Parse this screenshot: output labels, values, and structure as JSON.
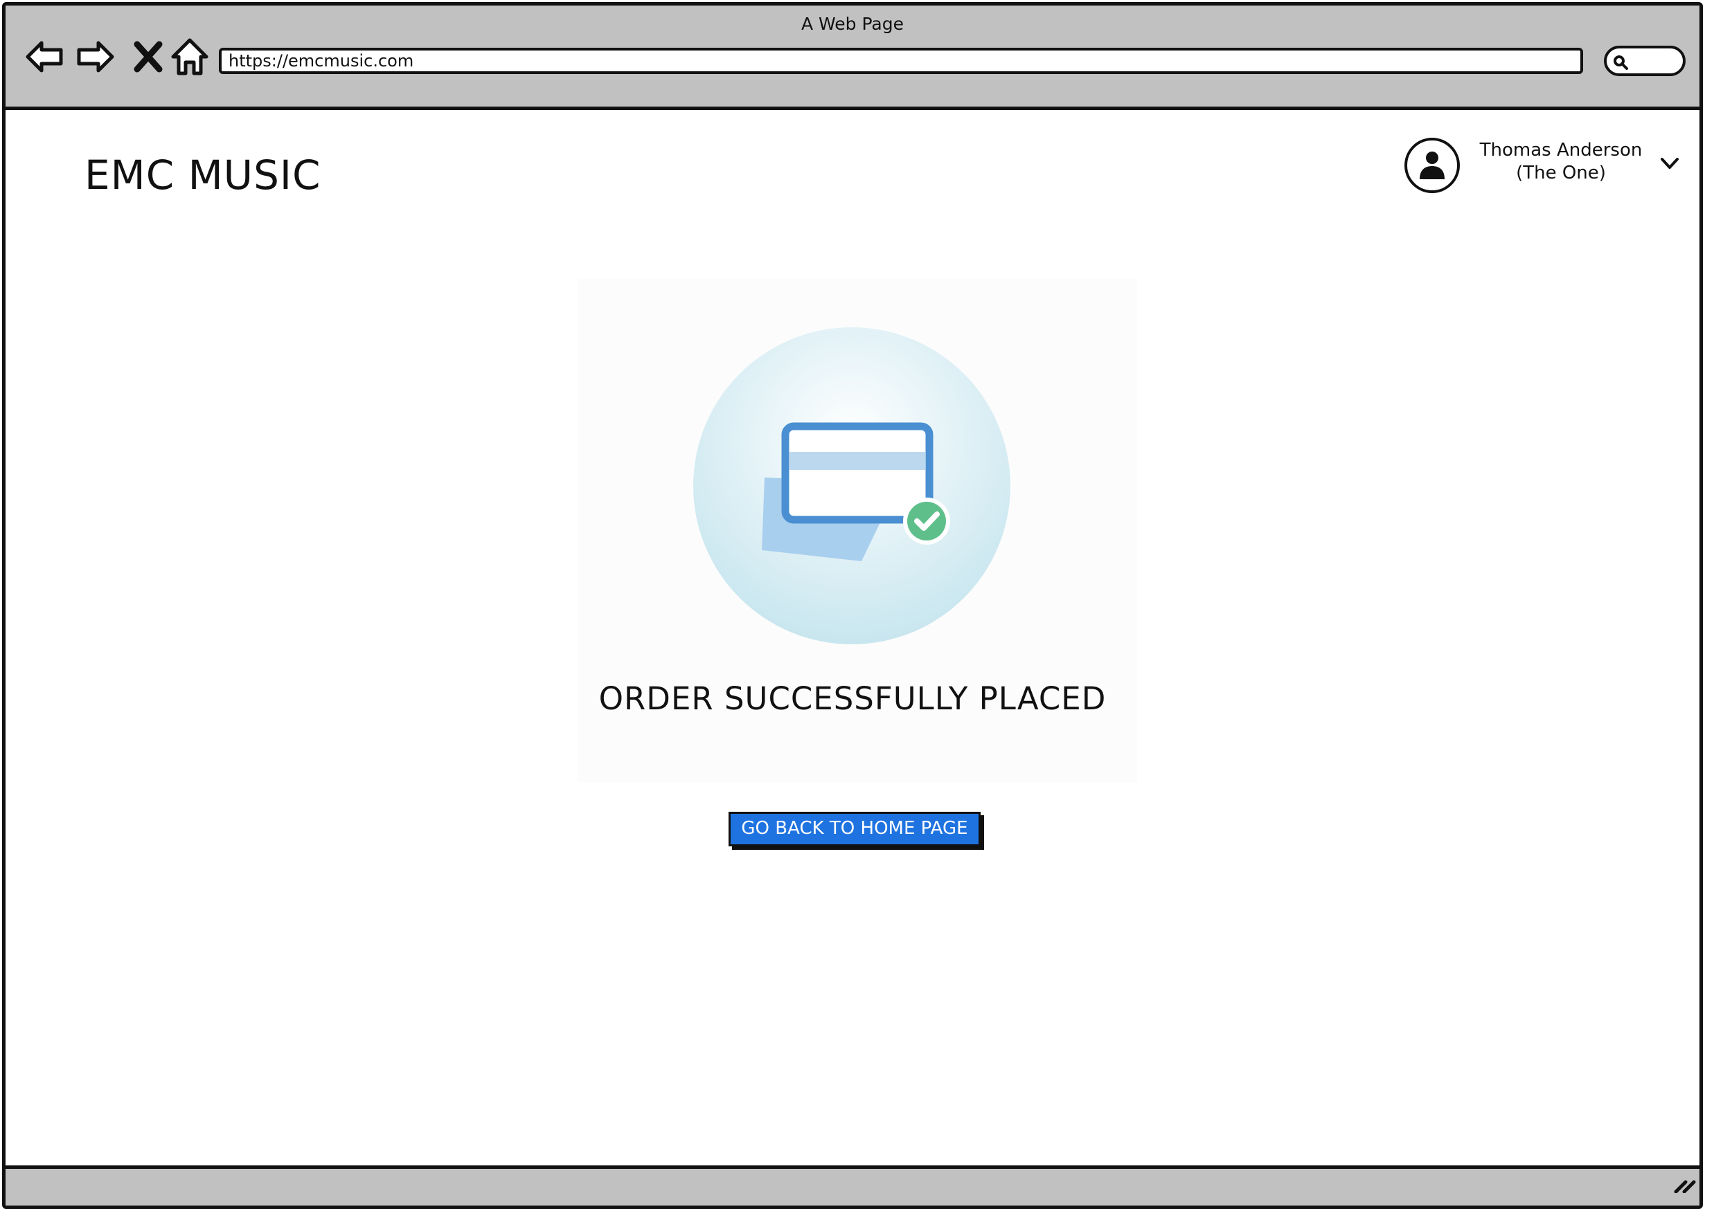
{
  "window": {
    "title": "A Web Page",
    "url": "https://emcmusic.com"
  },
  "nav_icons": [
    "back-arrow-icon",
    "forward-arrow-icon",
    "close-icon",
    "home-icon",
    "search-icon"
  ],
  "header": {
    "logo": "EMC MUSIC",
    "user": {
      "name": "Thomas Anderson",
      "subtitle": "(The One)"
    }
  },
  "main": {
    "illustration_icon": "credit-card-success-icon",
    "headline": "ORDER SUCCESSFULLY PLACED",
    "button_label": "GO BACK TO HOME PAGE"
  },
  "colors": {
    "chrome": "#c1c1c1",
    "button": "#1f73e0",
    "success": "#5fbf8a",
    "card": "#4a8fd1"
  }
}
